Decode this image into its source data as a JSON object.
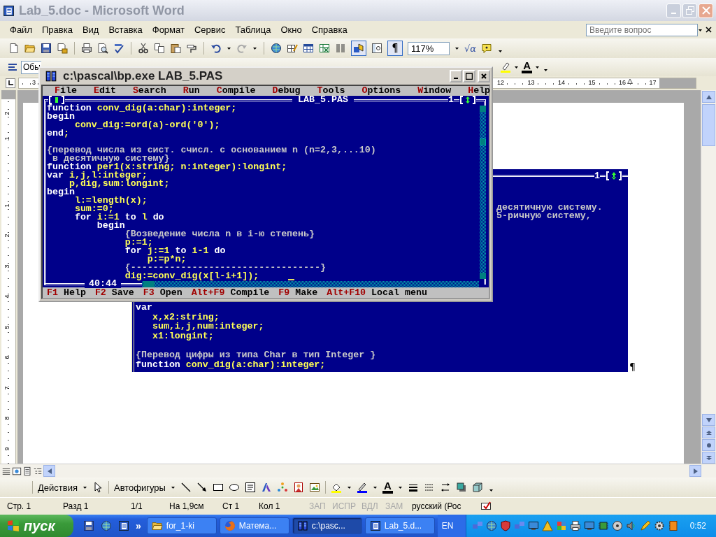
{
  "word": {
    "title": "Lab_5.doc - Microsoft Word",
    "menu": [
      "Файл",
      "Правка",
      "Вид",
      "Вставка",
      "Формат",
      "Сервис",
      "Таблица",
      "Окно",
      "Справка"
    ],
    "help_search": {
      "placeholder": "Введите вопрос"
    },
    "standard_toolbar": {
      "drawing_pressed": true,
      "marks_button": {
        "label": "¶",
        "selected": true
      },
      "zoom": "117%",
      "equation_label": "√α"
    },
    "formatting_toolbar": {
      "style": "Обы",
      "font_color_label": "A"
    },
    "ruler_labels": [
      "3",
      "12",
      "13",
      "14",
      "15",
      "16",
      "17"
    ],
    "vertical_ruler_labels": [
      "2",
      "1",
      "1",
      "2",
      "3",
      "4",
      "5",
      "6",
      "7",
      "8",
      "9"
    ],
    "embedded_screen": {
      "window_number": "1",
      "upper_lines": [
        [
          {
            "kind": "comment",
            "text": "десятичную систему."
          }
        ],
        [
          {
            "kind": "comment",
            "text": "5-ричную систему,"
          }
        ]
      ],
      "lower_lines": [
        [
          {
            "kind": "keyword",
            "text": "var"
          }
        ],
        [
          {
            "kind": "code",
            "text": "   x,x2:string;"
          }
        ],
        [
          {
            "kind": "code",
            "text": "   sum,i,j,num:integer;"
          }
        ],
        [
          {
            "kind": "code",
            "text": "   x1:longint;"
          }
        ],
        {
          "blank": true
        },
        [
          {
            "kind": "comment",
            "text": "{Перевод цифры из типа Char в тип Integer }"
          }
        ],
        [
          {
            "kind": "keyword",
            "text": "function "
          },
          {
            "kind": "code",
            "text": "conv_dig(a:char):integer;"
          }
        ]
      ]
    },
    "paragraph_mark": "¶",
    "drawing_toolbar": {
      "actions": "Действия",
      "autoshapes": "Автофигуры",
      "font_color_label": "A"
    },
    "status_bar": [
      {
        "label": "Стр. 1",
        "disabled": false
      },
      {
        "label": "Разд 1",
        "disabled": false
      },
      {
        "label": "1/1",
        "disabled": false
      },
      {
        "label": "На 1,9см",
        "disabled": false
      },
      {
        "label": "Ст 1",
        "disabled": false
      },
      {
        "label": "Кол 1",
        "disabled": false
      },
      {
        "label": "ЗАП",
        "disabled": true
      },
      {
        "label": "ИСПР",
        "disabled": true
      },
      {
        "label": "ВДЛ",
        "disabled": true
      },
      {
        "label": "ЗАМ",
        "disabled": true
      },
      {
        "label": "русский (Рос",
        "disabled": false
      }
    ]
  },
  "bp": {
    "title": "c:\\pascal\\bp.exe LAB_5.PAS",
    "menu": [
      "File",
      "Edit",
      "Search",
      "Run",
      "Compile",
      "Debug",
      "Tools",
      "Options",
      "Window",
      "Help"
    ],
    "file_title": "LAB_5.PAS",
    "window_number": "1",
    "position": "40:44",
    "lines": [
      [
        {
          "kind": "keyword",
          "text": "function "
        },
        {
          "kind": "code",
          "text": "conv_dig(a:char):integer;"
        }
      ],
      [
        {
          "kind": "keyword",
          "text": "begin"
        }
      ],
      [
        {
          "kind": "code",
          "text": "     conv_dig:=ord(a)-ord('0');"
        }
      ],
      [
        {
          "kind": "keyword",
          "text": "end"
        },
        {
          "kind": "code",
          "text": ";"
        }
      ],
      {
        "blank": true
      },
      [
        {
          "kind": "comment",
          "text": "{перевод числа из сист. счисл. с основанием n (n=2,3,...10)"
        }
      ],
      [
        {
          "kind": "comment",
          "text": " в десятичную систему}"
        }
      ],
      [
        {
          "kind": "keyword",
          "text": "function "
        },
        {
          "kind": "code",
          "text": "per1(x:string; n:integer):longint;"
        }
      ],
      [
        {
          "kind": "keyword",
          "text": "var "
        },
        {
          "kind": "code",
          "text": "i,j,l:integer;"
        }
      ],
      [
        {
          "kind": "code",
          "text": "    p,dig,sum:longint;"
        }
      ],
      [
        {
          "kind": "keyword",
          "text": "begin"
        }
      ],
      [
        {
          "kind": "code",
          "text": "     l:=length(x);"
        }
      ],
      [
        {
          "kind": "code",
          "text": "     sum:=0;"
        }
      ],
      [
        {
          "kind": "keyword",
          "text": "     for "
        },
        {
          "kind": "code",
          "text": "i:=1"
        },
        {
          "kind": "keyword",
          "text": " to "
        },
        {
          "kind": "code",
          "text": "l"
        },
        {
          "kind": "keyword",
          "text": " do"
        }
      ],
      [
        {
          "kind": "keyword",
          "text": "         begin"
        }
      ],
      [
        {
          "kind": "comment",
          "text": "              {Возведение числа n в i-ю степень}"
        }
      ],
      [
        {
          "kind": "code",
          "text": "              p:=1;"
        }
      ],
      [
        {
          "kind": "keyword",
          "text": "              for "
        },
        {
          "kind": "code",
          "text": "j:=1"
        },
        {
          "kind": "keyword",
          "text": " to "
        },
        {
          "kind": "code",
          "text": "i-1"
        },
        {
          "kind": "keyword",
          "text": " do"
        }
      ],
      [
        {
          "kind": "code",
          "text": "                  p:=p*n;"
        }
      ],
      [
        {
          "kind": "comment",
          "text": "              {----------------------------------}"
        }
      ],
      [
        {
          "kind": "code",
          "text": "              dig:=conv_dig(x[l-i+1]);"
        }
      ]
    ],
    "hints": [
      {
        "key": "F1",
        "label": "Help"
      },
      {
        "key": "F2",
        "label": "Save"
      },
      {
        "key": "F3",
        "label": "Open"
      },
      {
        "key": "Alt+F9",
        "label": "Compile"
      },
      {
        "key": "F9",
        "label": "Make"
      },
      {
        "key": "Alt+F10",
        "label": "Local menu"
      }
    ]
  },
  "taskbar": {
    "start": "пуск",
    "chevron": "»",
    "tasks": [
      {
        "kind": "folder",
        "label": "for_1-ki",
        "selected": false
      },
      {
        "kind": "browser",
        "label": "Матема...",
        "selected": false
      },
      {
        "kind": "dos",
        "label": "c:\\pasc...",
        "selected": true
      },
      {
        "kind": "word",
        "label": "Lab_5.d...",
        "selected": false
      }
    ],
    "language": "EN",
    "clock": "0:52"
  }
}
